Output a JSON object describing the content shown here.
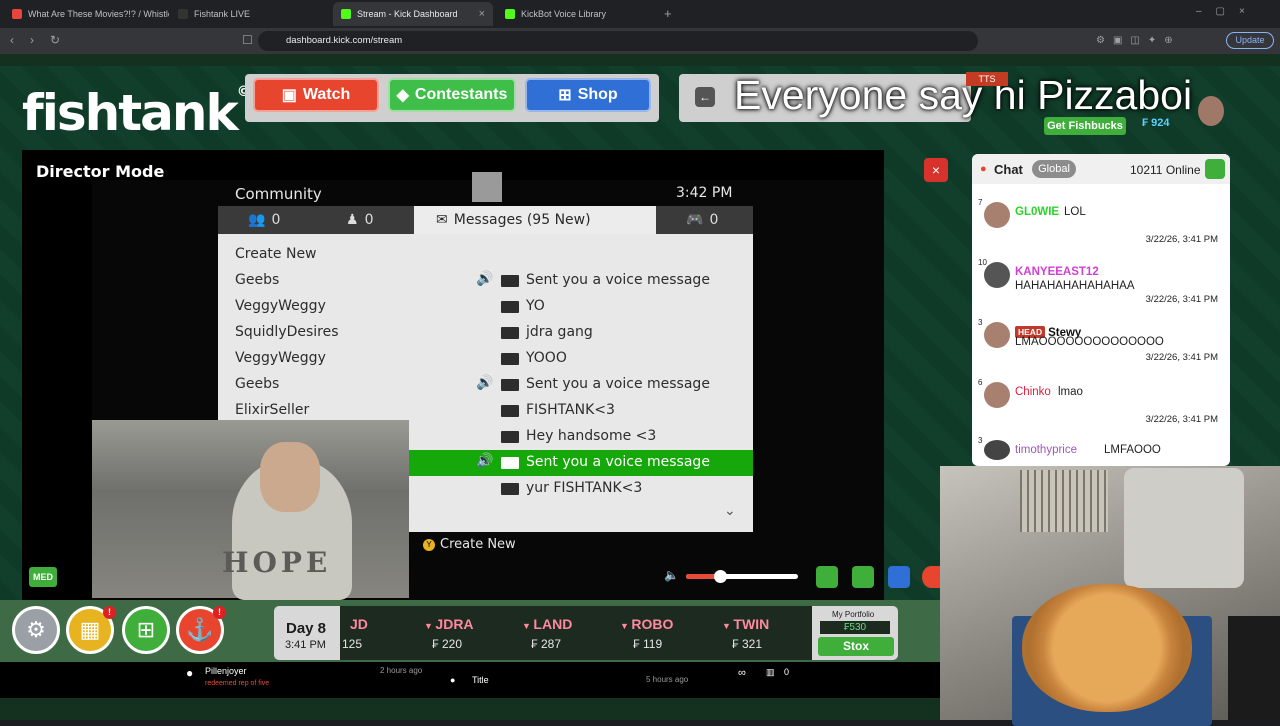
{
  "browser": {
    "tabs": [
      {
        "label": "What Are These Movies?!? / Whistle",
        "active": false
      },
      {
        "label": "Fishtank LIVE",
        "active": false
      },
      {
        "label": "Stream - Kick Dashboard",
        "active": true
      },
      {
        "label": "KickBot Voice Library",
        "active": false
      }
    ],
    "url": "dashboard.kick.com/stream",
    "update_label": "Update"
  },
  "site": {
    "logo": "fishtank",
    "logo_mark": "©",
    "nav": {
      "watch": "Watch",
      "contestants": "Contestants",
      "shop": "Shop"
    },
    "tts_badge": "TTS",
    "tts_overlay": "Everyone say hi Pizzaboi",
    "get_fishbucks": "Get Fishbucks",
    "fishbucks_amount": "₣ 924"
  },
  "director": {
    "title": "Director Mode",
    "close": "×",
    "med_badge": "MED"
  },
  "xbox": {
    "header": "Community",
    "time": "3:42  PM",
    "tabs": {
      "friends": "0",
      "party": "0",
      "messages": "Messages (95 New)",
      "games": "0"
    },
    "create_new": "Create New",
    "messages": [
      {
        "from": "Geebs",
        "text": "Sent you a voice message",
        "voice": true,
        "selected": false
      },
      {
        "from": "VeggyWeggy",
        "text": "YO",
        "voice": false,
        "selected": false
      },
      {
        "from": "SquidlyDesires",
        "text": "jdra gang",
        "voice": false,
        "selected": false
      },
      {
        "from": "VeggyWeggy",
        "text": "YOOO",
        "voice": false,
        "selected": false
      },
      {
        "from": "Geebs",
        "text": "Sent you a voice message",
        "voice": true,
        "selected": false
      },
      {
        "from": "ElixirSeller",
        "text": "FISHTANK<3",
        "voice": false,
        "selected": false
      },
      {
        "from": "",
        "text": "Hey handsome <3",
        "voice": false,
        "selected": false
      },
      {
        "from": "",
        "text": "Sent you a voice message",
        "voice": true,
        "selected": true
      },
      {
        "from": "",
        "text": "yur FISHTANK<3",
        "voice": false,
        "selected": false
      }
    ],
    "footer_button": "Y",
    "footer_action": "Create New"
  },
  "webcam": {
    "shirt_text": "HOPE"
  },
  "volume_level": 0.3,
  "bottom": {
    "badges": {
      "shop": "!",
      "anchor": "!"
    },
    "day": "Day 8",
    "day_time": "3:41 PM",
    "stocks": [
      {
        "ticker": "JD",
        "value": "125"
      },
      {
        "ticker": "JDRA",
        "value": "₣ 220"
      },
      {
        "ticker": "LAND",
        "value": "₣ 287"
      },
      {
        "ticker": "ROBO",
        "value": "₣ 119"
      },
      {
        "ticker": "TWIN",
        "value": "₣ 321"
      }
    ],
    "portfolio_label": "My Portfolio",
    "portfolio_value": "₣530",
    "stox": "Stox"
  },
  "notifications": [
    {
      "user": "Pillenjoyer",
      "text": "redeemed rep of five",
      "ago": "2 hours ago"
    },
    {
      "user": "",
      "text": "Title",
      "ago": "5 hours ago"
    }
  ],
  "notif_counts": {
    "infinity": "∞",
    "count": "0"
  },
  "chat": {
    "label": "Chat",
    "scope": "Global",
    "online": "10211 Online",
    "messages": [
      {
        "level": "7",
        "user": "GL0WIE",
        "user_color": "#2bd42b",
        "tag": "",
        "text": "LOL",
        "time": "3/22/26, 3:41 PM"
      },
      {
        "level": "10",
        "user": "KANYEEAST12",
        "user_color": "#d23fd2",
        "tag": "",
        "text": "HAHAHAHAHAHAHAA",
        "time": "3/22/26, 3:41 PM"
      },
      {
        "level": "3",
        "user": "Stewy",
        "user_color": "#111111",
        "tag": "HEAD",
        "text": "LMAOOOOOOOOOOOOOO",
        "time": "3/22/26, 3:41 PM"
      },
      {
        "level": "6",
        "user": "Chinko",
        "user_color": "#e0203a",
        "tag": "",
        "text": "lmao",
        "time": "3/22/26, 3:41 PM"
      },
      {
        "level": "3",
        "user": "timothyprice",
        "user_color": "#9b59b6",
        "tag": "",
        "text": "LMFAOOO",
        "time": ""
      }
    ]
  },
  "colors": {
    "accent_green": "#3fae3a",
    "selected_row": "#16a80b",
    "watch": "#e8452f",
    "contestants": "#3fbf4a",
    "shop": "#2f6fd6"
  }
}
